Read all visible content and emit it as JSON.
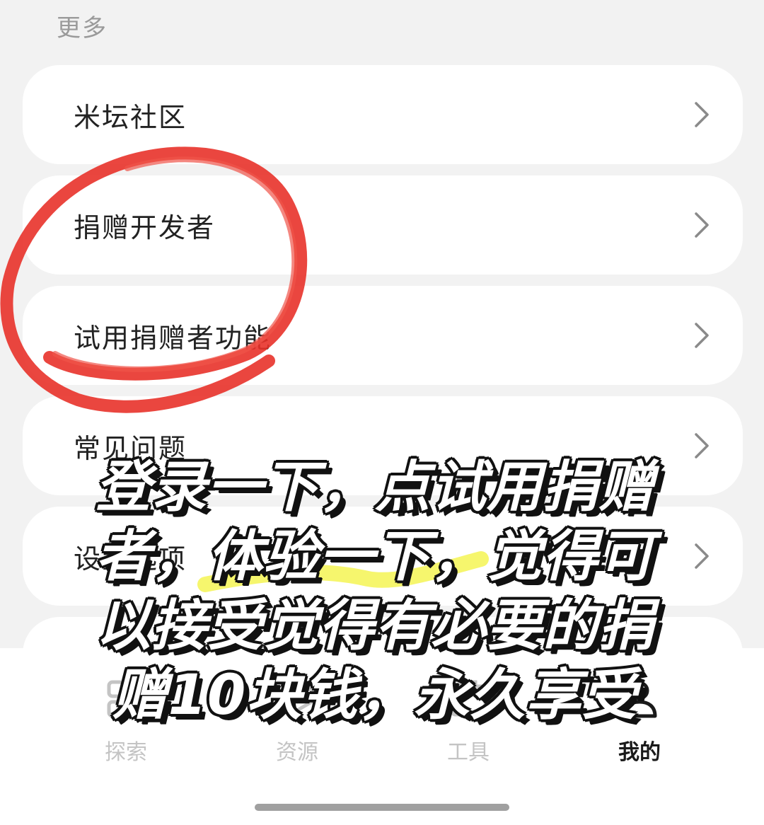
{
  "section": {
    "title": "更多"
  },
  "menu": {
    "items": [
      {
        "label": "米坛社区"
      },
      {
        "label": "捐赠开发者"
      },
      {
        "label": "试用捐赠者功能"
      },
      {
        "label": "常见问题"
      },
      {
        "label": "设置选项"
      },
      {
        "label": ""
      }
    ]
  },
  "nav": {
    "items": [
      {
        "label": "探索",
        "icon": "explore-icon",
        "active": false
      },
      {
        "label": "资源",
        "icon": "resource-icon",
        "active": false
      },
      {
        "label": "工具",
        "icon": "tools-icon",
        "active": false
      },
      {
        "label": "我的",
        "icon": "profile-icon",
        "active": true
      }
    ]
  },
  "overlay": {
    "caption": "登录一下，点试用捐赠者，体验一下，觉得可以接受觉得有必要的捐赠10块钱，永久享受"
  },
  "colors": {
    "background": "#f2f2f2",
    "card": "#ffffff",
    "annotation_circle": "#e8322a",
    "annotation_highlight": "#f4f554",
    "active_nav": "#1a1a1a",
    "inactive_nav": "#c4c4c4"
  }
}
